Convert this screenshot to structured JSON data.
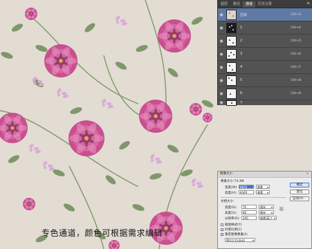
{
  "canvas": {
    "caption": "专色通道，颜色可根据需求编辑"
  },
  "colors": {
    "background": "#e2dcd3",
    "peony_pink": "#c94f8f",
    "peony_dark": "#8c2a63",
    "leaf_green": "#6f8a58",
    "lilac": "#d9a8d8",
    "panel_bg": "#535353",
    "panel_selected": "#5f7aa4"
  },
  "channels_panel": {
    "tabs": [
      "图层",
      "路径",
      "通道",
      "历史记录"
    ],
    "active_tab": "通道",
    "menu_icon": "panel-menu-icon",
    "rows": [
      {
        "name": "压纹",
        "shortcut": "Ctrl+3",
        "selected": true
      },
      {
        "name": "1",
        "shortcut": "Ctrl+4",
        "selected": false
      },
      {
        "name": "2",
        "shortcut": "Ctrl+5",
        "selected": false
      },
      {
        "name": "3",
        "shortcut": "Ctrl+6",
        "selected": false
      },
      {
        "name": "4",
        "shortcut": "Ctrl+7",
        "selected": false
      },
      {
        "name": "5",
        "shortcut": "Ctrl+8",
        "selected": false
      },
      {
        "name": "6",
        "shortcut": "Ctrl+9",
        "selected": false
      },
      {
        "name": "7",
        "shortcut": "",
        "selected": false
      }
    ]
  },
  "image_size_dialog": {
    "title": "图像大小",
    "close_label": "×",
    "pixel_size_label": "像素大小:74.3M",
    "width_label": "宽度(W):",
    "width_value": "8850",
    "height_label": "高度(H):",
    "height_value": "8449",
    "pixel_unit": "像素",
    "doc_size_label": "文档大小:",
    "doc_width_label": "宽度(D):",
    "doc_width_value": "70",
    "doc_height_label": "高度(G):",
    "doc_height_value": "80",
    "resolution_label": "分辨率(R):",
    "resolution_value": "200",
    "cm_unit": "厘米",
    "res_unit": "像素/英寸",
    "scale_styles_label": "缩放样式(Y)",
    "constrain_label": "约束比例(C)",
    "resample_label": "重定图像像素(I):",
    "resample_method": "两次立方(自动)",
    "ok_label": "确定",
    "cancel_label": "复位",
    "auto_label": "自动(A)..."
  }
}
